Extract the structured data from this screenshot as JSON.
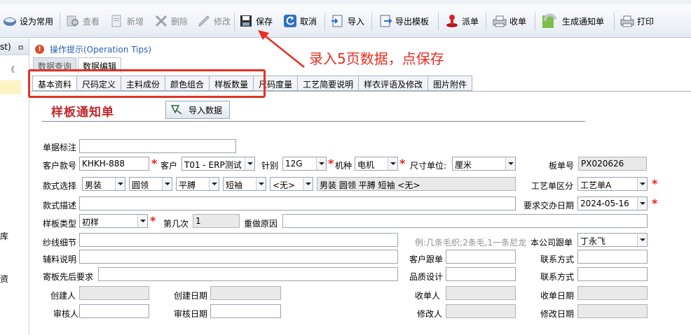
{
  "toolbar": {
    "items": [
      {
        "label": "设为常用",
        "icon": "favorite-icon"
      },
      {
        "label": "查看",
        "icon": "view-icon"
      },
      {
        "label": "新增",
        "icon": "new-icon"
      },
      {
        "label": "删除",
        "icon": "delete-icon"
      },
      {
        "label": "修改",
        "icon": "edit-icon"
      },
      {
        "label": "保存",
        "icon": "save-icon"
      },
      {
        "label": "取消",
        "icon": "cancel-icon"
      },
      {
        "label": "导入",
        "icon": "import-icon"
      },
      {
        "label": "导出模板",
        "icon": "export-template-icon"
      },
      {
        "label": "派单",
        "icon": "dispatch-icon"
      },
      {
        "label": "收单",
        "icon": "receive-icon"
      },
      {
        "label": "生成通知单",
        "icon": "generate-notice-icon"
      },
      {
        "label": "打印",
        "icon": "print-icon"
      }
    ]
  },
  "left_pane": {
    "header": "st)",
    "pin": "ㅁ",
    "collapse": "《",
    "side_chars": [
      "库",
      "资"
    ]
  },
  "tips": {
    "label": "操作提示(Operation Tips)"
  },
  "annotation": {
    "text": "录入5页数据，点保存"
  },
  "upper_tabs": [
    "数据查询",
    "数据编辑"
  ],
  "lower_tabs": [
    "基本资料",
    "尺码定义",
    "主料成份",
    "颜色组合",
    "样板数量",
    "尺码度量",
    "工艺简要说明",
    "样衣评语及修改",
    "图片附件"
  ],
  "form": {
    "title": "样板通知单",
    "import_button": "导入数据",
    "doc_note_label": "单据标注",
    "customer_style_no_label": "客户款号",
    "customer_style_no": "KHKH-888",
    "customer_label": "客户",
    "customer": "T01 - ERP测试",
    "needle_label": "针别",
    "needle": "12G",
    "machine_label": "机种",
    "machine": "电机",
    "size_unit_label": "尺寸单位:",
    "size_unit": "厘米",
    "board_no_label": "板单号",
    "board_no": "PX020626",
    "style_select_label": "款式选择",
    "style_options": [
      "男装",
      "圆领",
      "平膊",
      "短袖",
      "<无>"
    ],
    "style_summary": "男装 圆领 平膊 短袖 <无>",
    "process_type_label": "工艺单区分",
    "process_type": "工艺单A",
    "style_desc_label": "款式描述",
    "delivery_date_label": "要求交办日期",
    "delivery_date": "2024-05-16",
    "sample_type_label": "样板类型",
    "sample_type": "初样",
    "round_label": "第几次",
    "round": "1",
    "redo_reason_label": "重做原因",
    "yarn_detail_label": "纱线细节",
    "yarn_hint": "例:几条毛织;2条毛,1一条尼龙",
    "company_follow_label": "本公司跟单",
    "company_follow": "丁永飞",
    "aux_note_label": "辅料说明",
    "customer_follow_label": "客户跟单",
    "contact_label_1": "联系方式",
    "send_req_label": "寄板先后要求",
    "quality_design_label": "品质设计",
    "contact_label_2": "联系方式",
    "creator_label": "创建人",
    "create_date_label": "创建日期",
    "receiver_label": "收单人",
    "receive_date_label": "收单日期",
    "auditor_label": "审核人",
    "audit_date_label": "审核日期",
    "modifier_label": "修改人",
    "modify_date_label": "修改日期"
  }
}
